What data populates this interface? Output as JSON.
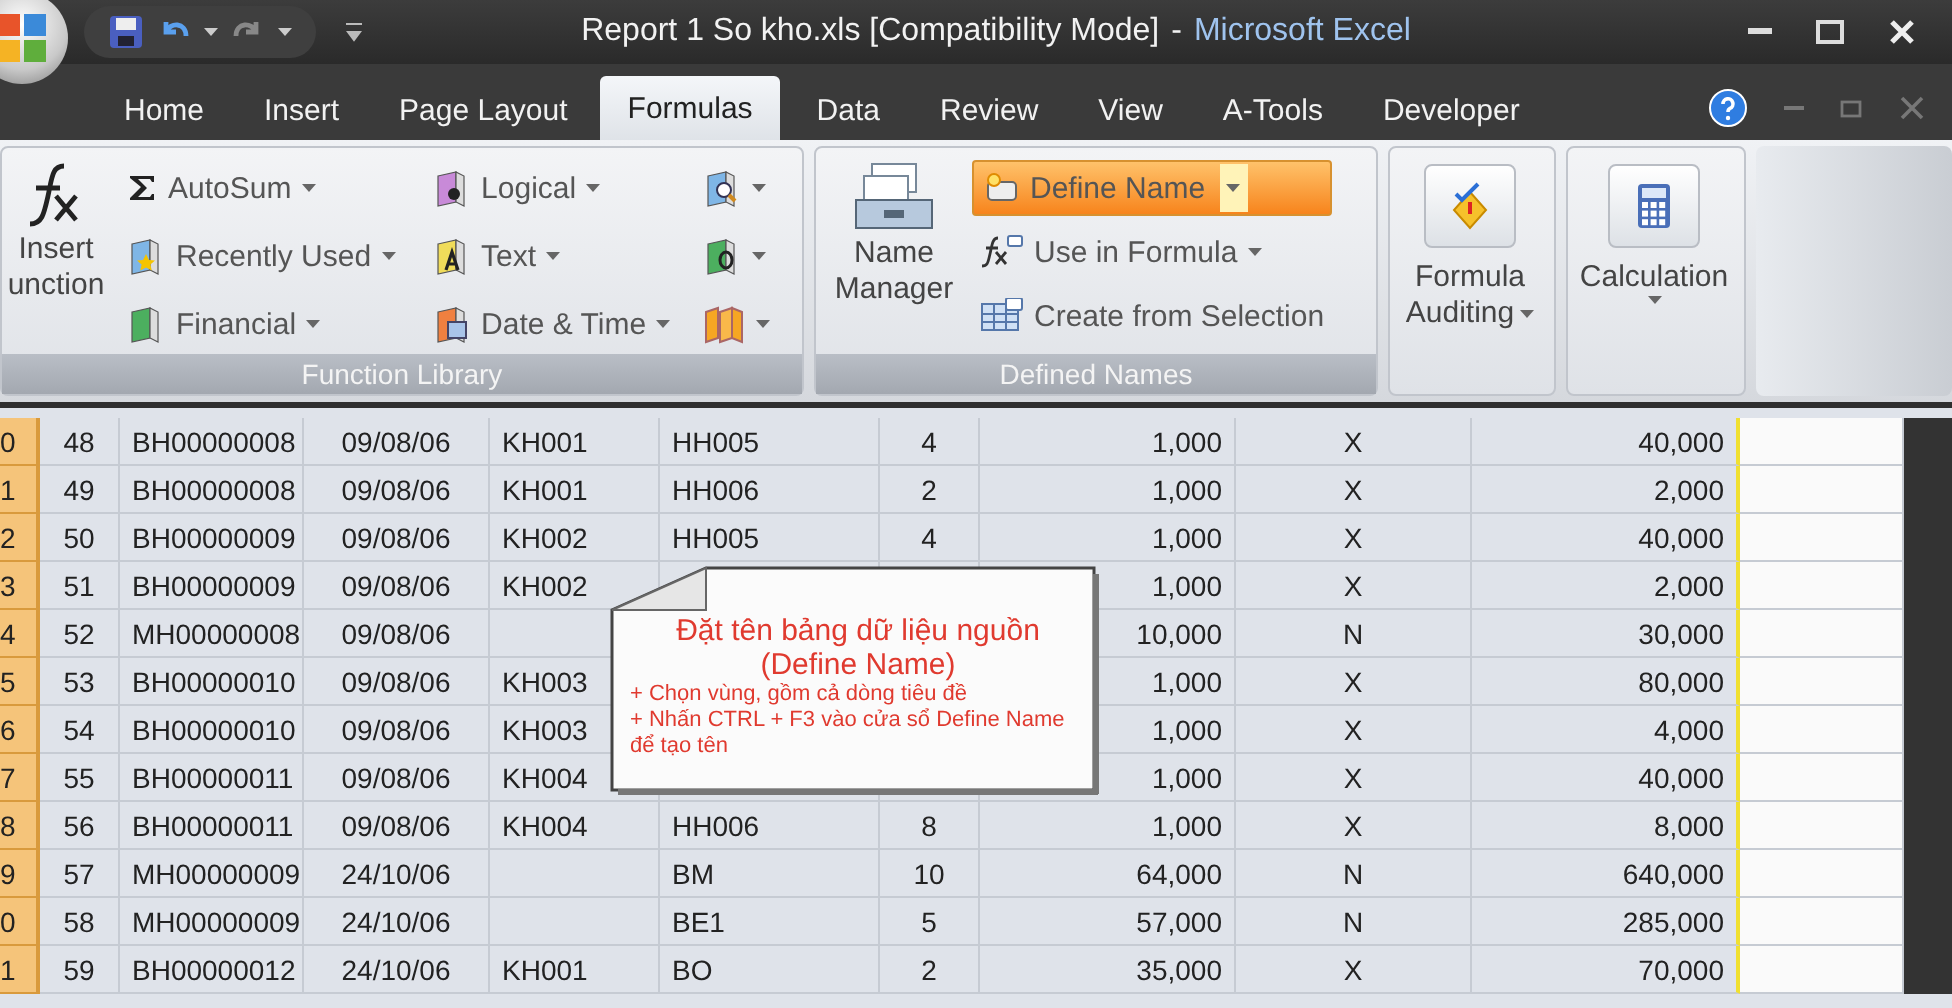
{
  "window": {
    "title": "Report 1 So kho.xls  [Compatibility Mode]",
    "separator": "-",
    "app_name": "Microsoft Excel"
  },
  "tabs": [
    {
      "label": "Home",
      "selected": false
    },
    {
      "label": "Insert",
      "selected": false
    },
    {
      "label": "Page Layout",
      "selected": false
    },
    {
      "label": "Formulas",
      "selected": true
    },
    {
      "label": "Data",
      "selected": false
    },
    {
      "label": "Review",
      "selected": false
    },
    {
      "label": "View",
      "selected": false
    },
    {
      "label": "A-Tools",
      "selected": false
    },
    {
      "label": "Developer",
      "selected": false
    }
  ],
  "ribbon": {
    "function_library": {
      "label": "Function Library",
      "insert_function": [
        "Insert",
        "unction"
      ],
      "column_1": [
        "AutoSum",
        "Recently Used",
        "Financial"
      ],
      "column_2": [
        "Logical",
        "Text",
        "Date & Time"
      ]
    },
    "defined_names": {
      "label": "Defined Names",
      "name_manager": [
        "Name",
        "Manager"
      ],
      "commands": [
        {
          "label": "Define Name",
          "kind": "split",
          "highlighted": true
        },
        {
          "label": "Use in Formula",
          "kind": "dropdown",
          "highlighted": false
        },
        {
          "label": "Create from Selection",
          "kind": "plain",
          "highlighted": false
        }
      ]
    },
    "formula_auditing": [
      "Formula",
      "Auditing"
    ],
    "calculation": [
      "Calculation"
    ]
  },
  "sheet": {
    "rows": [
      {
        "row_header": "0",
        "no": "48",
        "code": "BH00000008",
        "date": "09/08/06",
        "customer": "KH001",
        "product": "HH005",
        "qty": "4",
        "price": "1,000",
        "type": "X",
        "amount": "40,000"
      },
      {
        "row_header": "1",
        "no": "49",
        "code": "BH00000008",
        "date": "09/08/06",
        "customer": "KH001",
        "product": "HH006",
        "qty": "2",
        "price": "1,000",
        "type": "X",
        "amount": "2,000"
      },
      {
        "row_header": "2",
        "no": "50",
        "code": "BH00000009",
        "date": "09/08/06",
        "customer": "KH002",
        "product": "HH005",
        "qty": "4",
        "price": "1,000",
        "type": "X",
        "amount": "40,000"
      },
      {
        "row_header": "3",
        "no": "51",
        "code": "BH00000009",
        "date": "09/08/06",
        "customer": "KH002",
        "price": "1,000",
        "type": "X",
        "amount": "2,000"
      },
      {
        "row_header": "4",
        "no": "52",
        "code": "MH00000008",
        "date": "09/08/06",
        "price": "10,000",
        "type": "N",
        "amount": "30,000"
      },
      {
        "row_header": "5",
        "no": "53",
        "code": "BH00000010",
        "date": "09/08/06",
        "customer": "KH003",
        "price": "1,000",
        "type": "X",
        "amount": "80,000"
      },
      {
        "row_header": "6",
        "no": "54",
        "code": "BH00000010",
        "date": "09/08/06",
        "customer": "KH003",
        "price": "1,000",
        "type": "X",
        "amount": "4,000"
      },
      {
        "row_header": "7",
        "no": "55",
        "code": "BH00000011",
        "date": "09/08/06",
        "customer": "KH004",
        "price": "1,000",
        "type": "X",
        "amount": "40,000"
      },
      {
        "row_header": "8",
        "no": "56",
        "code": "BH00000011",
        "date": "09/08/06",
        "customer": "KH004",
        "product": "HH006",
        "qty": "8",
        "price": "1,000",
        "type": "X",
        "amount": "8,000"
      },
      {
        "row_header": "9",
        "no": "57",
        "code": "MH00000009",
        "date": "24/10/06",
        "product": "BM",
        "qty": "10",
        "price": "64,000",
        "type": "N",
        "amount": "640,000"
      },
      {
        "row_header": "0",
        "no": "58",
        "code": "MH00000009",
        "date": "24/10/06",
        "product": "BE1",
        "qty": "5",
        "price": "57,000",
        "type": "N",
        "amount": "285,000"
      },
      {
        "row_header": "1",
        "no": "59",
        "code": "BH00000012",
        "date": "24/10/06",
        "customer": "KH001",
        "product": "BO",
        "qty": "2",
        "price": "35,000",
        "type": "X",
        "amount": "70,000"
      }
    ]
  },
  "callout": {
    "title": "Đặt tên bảng dữ liệu nguồn",
    "subtitle": "(Define Name)",
    "notes": [
      "+ Chọn vùng, gồm cả dòng tiêu đề",
      "+ Nhấn CTRL + F3 vào cửa sổ Define Name để tạo tên"
    ]
  }
}
